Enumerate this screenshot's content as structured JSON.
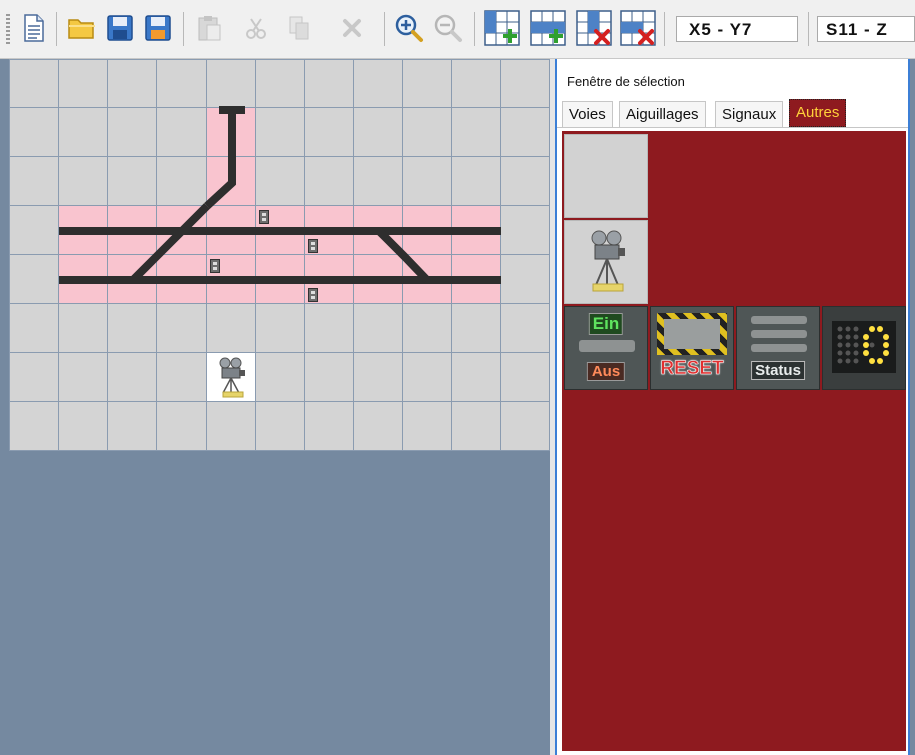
{
  "toolbar": {
    "buttons": [
      {
        "name": "new-file-button",
        "icon": "new-document-icon"
      },
      {
        "name": "open-button",
        "icon": "folder-open-icon"
      },
      {
        "name": "save-button",
        "icon": "floppy-disk-icon"
      },
      {
        "name": "save-as-button",
        "icon": "floppy-disk-edit-icon"
      },
      {
        "name": "paste-button",
        "icon": "paste-icon"
      },
      {
        "name": "cut-button",
        "icon": "scissors-icon"
      },
      {
        "name": "copy-button",
        "icon": "copy-icon"
      },
      {
        "name": "delete-button",
        "icon": "delete-x-icon"
      },
      {
        "name": "zoom-in-button",
        "icon": "zoom-in-icon"
      },
      {
        "name": "zoom-out-button",
        "icon": "zoom-out-icon"
      },
      {
        "name": "add-row-button",
        "icon": "grid-add-row-icon"
      },
      {
        "name": "add-column-button",
        "icon": "grid-add-column-icon"
      },
      {
        "name": "delete-row-button",
        "icon": "grid-delete-row-icon"
      },
      {
        "name": "delete-column-button",
        "icon": "grid-delete-column-icon"
      }
    ],
    "position_readout": "X5 - Y7",
    "size_readout": "S11 - Z"
  },
  "panel": {
    "title": "Fenêtre de sélection",
    "tabs": [
      "Voies",
      "Aiguillages",
      "Signaux",
      "Autres"
    ],
    "active_tab": "Autres",
    "tiles": {
      "on_off": {
        "on": "Ein",
        "off": "Aus"
      },
      "reset": "RESET",
      "status": "Status"
    }
  },
  "colors": {
    "panel_background": "#8e1a1f",
    "active_tab_text": "#ffd23a",
    "track_cell": "#f9c4cf",
    "canvas_background": "#d4d4d4",
    "workspace_background": "#7589a0",
    "panel_border": "#3c7fd6"
  }
}
